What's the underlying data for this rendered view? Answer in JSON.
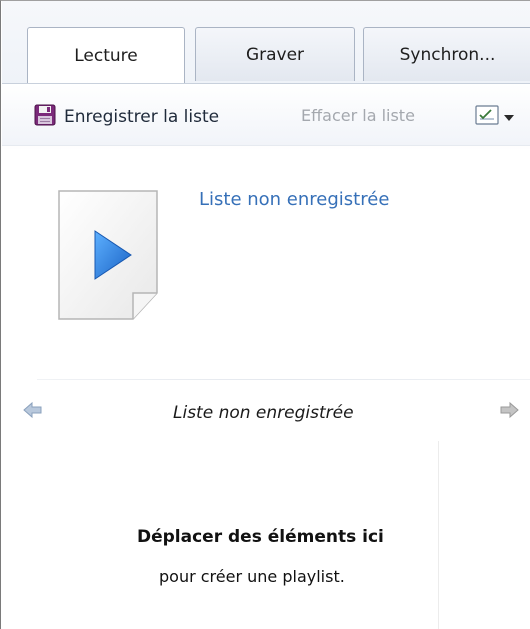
{
  "tabs": [
    {
      "label": "Lecture",
      "active": true
    },
    {
      "label": "Graver",
      "active": false
    },
    {
      "label": "Synchron...",
      "active": false
    }
  ],
  "toolbar": {
    "save_label": "Enregistrer la liste",
    "clear_label": "Effacer la liste",
    "save_icon": "floppy-disk-icon",
    "options_icon": "list-options-icon"
  },
  "playlist": {
    "title": "Liste non enregistrée",
    "icon": "media-playlist-icon"
  },
  "navigator": {
    "title": "Liste non enregistrée",
    "prev_icon": "arrow-left-icon",
    "next_icon": "arrow-right-icon"
  },
  "drop_zone": {
    "main_text": "Déplacer des éléments ici",
    "sub_text": "pour créer une playlist."
  },
  "colors": {
    "link_blue": "#3670b8",
    "disabled_text": "#a4a8ae",
    "play_blue": "#2a7fd8"
  }
}
